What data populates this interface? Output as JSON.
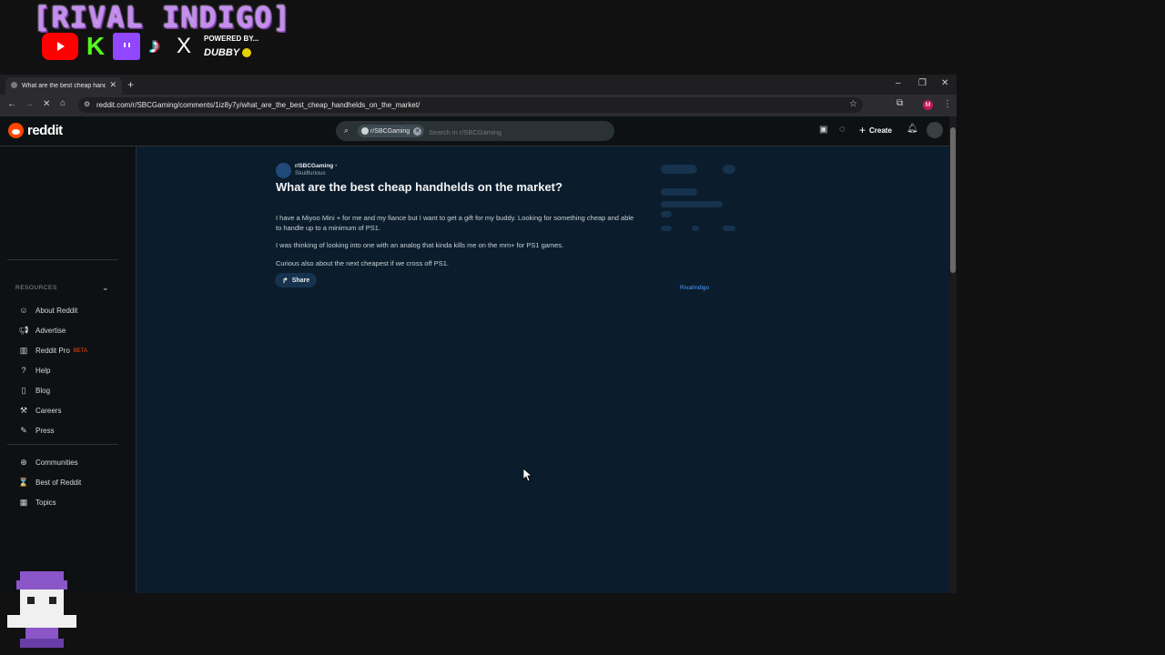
{
  "overlay": {
    "title": "[RIVAL INDIGO]",
    "powered_by": "POWERED BY...",
    "sponsor": "DUBBY"
  },
  "browser": {
    "tab_title": "What are the best cheap handheld",
    "url": "reddit.com/r/SBCGaming/comments/1iz8y7y/what_are_the_best_cheap_handhelds_on_the_market/",
    "profile_initial": "M"
  },
  "reddit": {
    "logo": "reddit",
    "search_chip": "r/SBCGaming",
    "search_placeholder": "Search in r/SBCGaming",
    "create_label": "Create"
  },
  "sidebar": {
    "resources_label": "RESOURCES",
    "items": [
      {
        "label": "About Reddit",
        "icon": "reddit-alien-icon"
      },
      {
        "label": "Advertise",
        "icon": "megaphone-icon"
      },
      {
        "label": "Reddit Pro",
        "badge": "BETA",
        "icon": "bar-chart-icon"
      },
      {
        "label": "Help",
        "icon": "help-icon"
      },
      {
        "label": "Blog",
        "icon": "book-icon"
      },
      {
        "label": "Careers",
        "icon": "wrench-icon"
      },
      {
        "label": "Press",
        "icon": "pencil-icon"
      }
    ],
    "items2": [
      {
        "label": "Communities",
        "icon": "communities-icon"
      },
      {
        "label": "Best of Reddit",
        "icon": "best-icon"
      },
      {
        "label": "Topics",
        "icon": "topics-icon"
      }
    ]
  },
  "post": {
    "subreddit": "r/SBCGaming",
    "dot": "•",
    "author": "Skullfurious",
    "title": "What are the best cheap handhelds on the market?",
    "paragraphs": [
      "I have a Miyoo Mini + for me and my fiance but I want to get a gift for my buddy. Looking for something cheap and able to handle up to a minimum of PS1.",
      "I was thinking of looking into one with an analog that kinda kills me on the mm+ for PS1 games.",
      "Curious also about the next cheapest if we cross off PS1."
    ],
    "share_label": "Share",
    "side_username": "RivalIndigo"
  },
  "colors": {
    "accent": "#ff4500",
    "main_bg": "#0b1c2c",
    "link": "#4c9cff"
  }
}
